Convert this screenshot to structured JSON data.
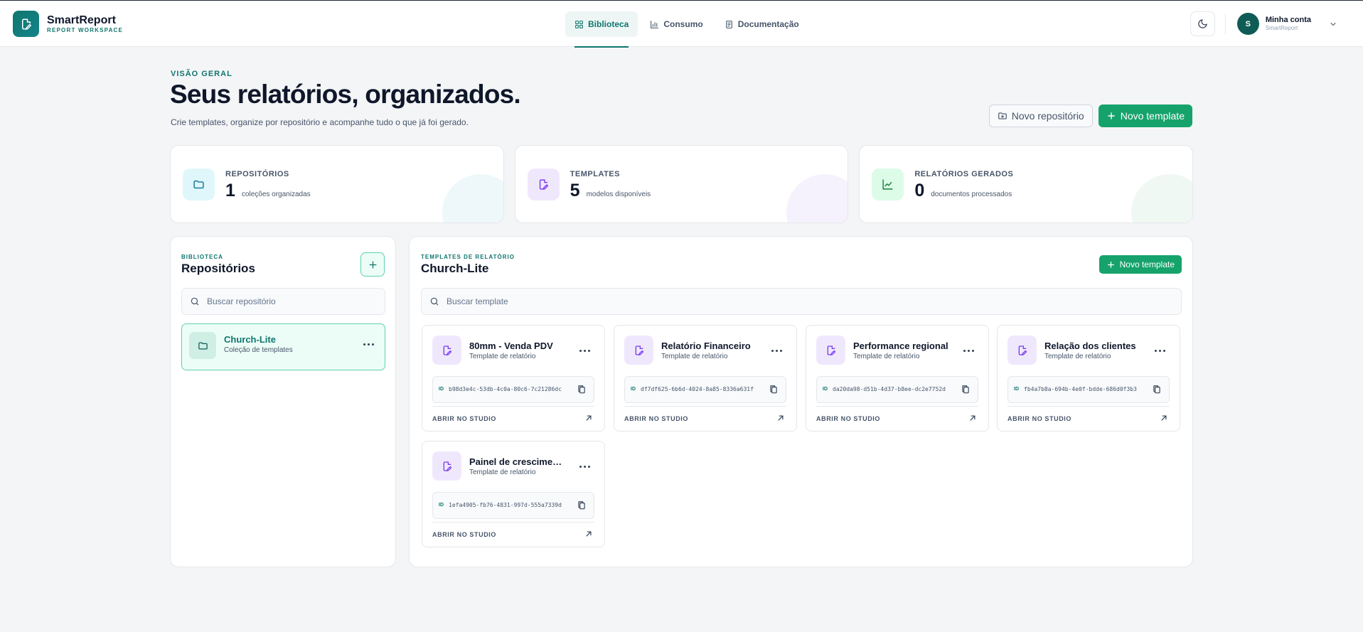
{
  "brand": {
    "name": "SmartReport",
    "subtitle": "REPORT WORKSPACE"
  },
  "nav": [
    {
      "label": "Biblioteca",
      "icon": "grid-icon",
      "active": true
    },
    {
      "label": "Consumo",
      "icon": "bar-chart-icon",
      "active": false
    },
    {
      "label": "Documentação",
      "icon": "document-icon",
      "active": false
    }
  ],
  "account": {
    "initial": "S",
    "name": "Minha conta",
    "subtitle": "SmartReport"
  },
  "hero": {
    "eyebrow": "VISÃO GERAL",
    "title": "Seus relatórios, organizados.",
    "subtitle": "Crie templates, organize por repositório e acompanhe tudo o que já foi gerado.",
    "new_repo_label": "Novo repositório",
    "new_template_label": "Novo template"
  },
  "stats": [
    {
      "label": "REPOSITÓRIOS",
      "value": "1",
      "desc": "coleções organizadas",
      "icon": "folder-icon",
      "color": "#0e7490",
      "bg": "#dff7fb"
    },
    {
      "label": "TEMPLATES",
      "value": "5",
      "desc": "modelos disponíveis",
      "icon": "pen-file-icon",
      "color": "#7c3aed",
      "bg": "#efe8fd"
    },
    {
      "label": "RELATÓRIOS GERADOS",
      "value": "0",
      "desc": "documentos processados",
      "icon": "trend-chart-icon",
      "color": "#15803d",
      "bg": "#dcfce7"
    }
  ],
  "library": {
    "eyebrow": "BIBLIOTECA",
    "title": "Repositórios",
    "search_placeholder": "Buscar repositório",
    "repos": [
      {
        "name": "Church-Lite",
        "sub": "Coleção de templates"
      }
    ]
  },
  "templates_panel": {
    "eyebrow": "TEMPLATES DE RELATÓRIO",
    "title": "Church-Lite",
    "new_template_label": "Novo template",
    "search_placeholder": "Buscar template",
    "id_tag": "ID",
    "open_label": "ABRIR NO STUDIO",
    "templates": [
      {
        "name": "80mm - Venda PDV",
        "sub": "Template de relatório",
        "id": "b98d3e4c-53db-4c0a-80c6-7c21286dc"
      },
      {
        "name": "Relatório Financeiro",
        "sub": "Template de relatório",
        "id": "df7df625-6b6d-4024-8a85-8336a631f"
      },
      {
        "name": "Performance regional",
        "sub": "Template de relatório",
        "id": "da20da98-d51b-4d37-b8ee-dc2e7752d"
      },
      {
        "name": "Relação dos clientes",
        "sub": "Template de relatório",
        "id": "fb4a7b8a-694b-4e0f-bdde-686d0f3b3"
      },
      {
        "name": "Painel de crescimento",
        "sub": "Template de relatório",
        "id": "1efa4905-fb76-4831-997d-555a7339d"
      }
    ]
  },
  "colors": {
    "brand": "#0f766e",
    "primary_button": "#16a36b",
    "accent_purple": "#7c3aed"
  }
}
